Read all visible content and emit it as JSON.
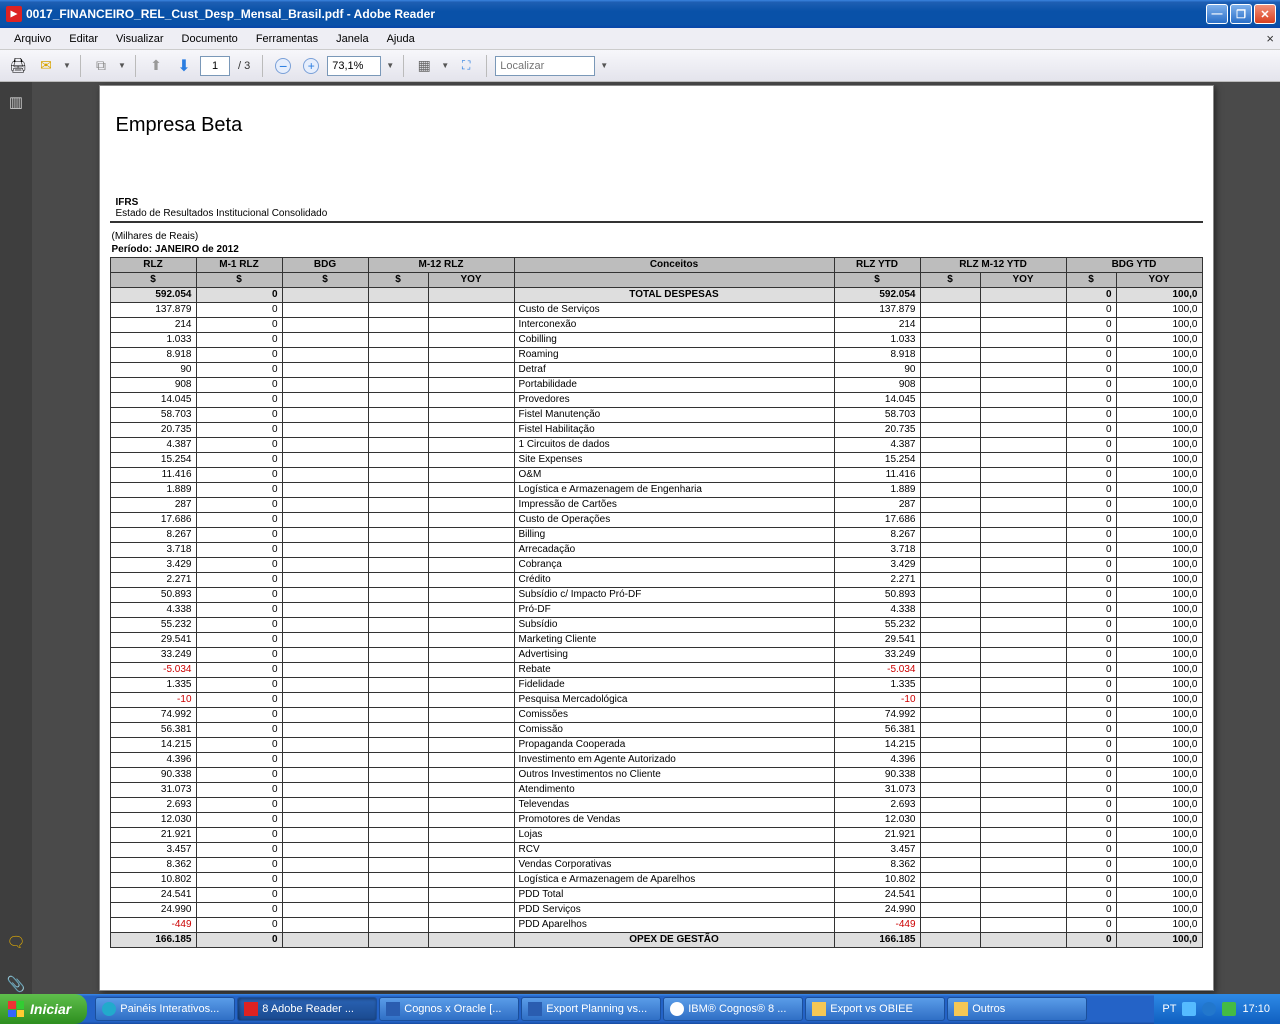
{
  "window": {
    "title": "0017_FINANCEIRO_REL_Cust_Desp_Mensal_Brasil.pdf - Adobe Reader"
  },
  "menu": [
    "Arquivo",
    "Editar",
    "Visualizar",
    "Documento",
    "Ferramentas",
    "Janela",
    "Ajuda"
  ],
  "toolbar": {
    "page_current": "1",
    "page_count": "/ 3",
    "zoom": "73,1%",
    "find_placeholder": "Localizar"
  },
  "document": {
    "company": "Empresa Beta",
    "ifrs": "IFRS",
    "ifrs_sub": "Estado de Resultados Institucional Consolidado",
    "currency_note": "(Milhares de Reais)",
    "period": "Período: JANEIRO de 2012",
    "headers1": [
      "RLZ",
      "M-1 RLZ",
      "BDG",
      "M-12 RLZ",
      "",
      "Conceitos",
      "RLZ YTD",
      "RLZ M-12 YTD",
      "",
      "BDG YTD",
      ""
    ],
    "headers2": [
      "$",
      "$",
      "$",
      "$",
      "YOY",
      "",
      "$",
      "$",
      "YOY",
      "$",
      "YOY"
    ],
    "total_row": {
      "rlz": "592.054",
      "m1": "0",
      "bdg": "",
      "m12": "",
      "yoy": "",
      "concept": "TOTAL DESPESAS",
      "rlz_ytd": "592.054",
      "m12_ytd": "",
      "yoy2": "",
      "bdg_ytd": "0",
      "yoy3": "100,0"
    },
    "rows": [
      {
        "rlz": "137.879",
        "m1": "0",
        "bdg": "",
        "m12": "",
        "yoy": "",
        "concept": "Custo de Serviços",
        "rlz_ytd": "137.879",
        "m12_ytd": "",
        "yoy2": "",
        "bdg_ytd": "0",
        "yoy3": "100,0"
      },
      {
        "rlz": "214",
        "m1": "0",
        "bdg": "",
        "m12": "",
        "yoy": "",
        "concept": "Interconexão",
        "rlz_ytd": "214",
        "m12_ytd": "",
        "yoy2": "",
        "bdg_ytd": "0",
        "yoy3": "100,0"
      },
      {
        "rlz": "1.033",
        "m1": "0",
        "bdg": "",
        "m12": "",
        "yoy": "",
        "concept": "Cobilling",
        "rlz_ytd": "1.033",
        "m12_ytd": "",
        "yoy2": "",
        "bdg_ytd": "0",
        "yoy3": "100,0"
      },
      {
        "rlz": "8.918",
        "m1": "0",
        "bdg": "",
        "m12": "",
        "yoy": "",
        "concept": "Roaming",
        "rlz_ytd": "8.918",
        "m12_ytd": "",
        "yoy2": "",
        "bdg_ytd": "0",
        "yoy3": "100,0"
      },
      {
        "rlz": "90",
        "m1": "0",
        "bdg": "",
        "m12": "",
        "yoy": "",
        "concept": "Detraf",
        "rlz_ytd": "90",
        "m12_ytd": "",
        "yoy2": "",
        "bdg_ytd": "0",
        "yoy3": "100,0"
      },
      {
        "rlz": "908",
        "m1": "0",
        "bdg": "",
        "m12": "",
        "yoy": "",
        "concept": "Portabilidade",
        "rlz_ytd": "908",
        "m12_ytd": "",
        "yoy2": "",
        "bdg_ytd": "0",
        "yoy3": "100,0"
      },
      {
        "rlz": "14.045",
        "m1": "0",
        "bdg": "",
        "m12": "",
        "yoy": "",
        "concept": "Provedores",
        "rlz_ytd": "14.045",
        "m12_ytd": "",
        "yoy2": "",
        "bdg_ytd": "0",
        "yoy3": "100,0"
      },
      {
        "rlz": "58.703",
        "m1": "0",
        "bdg": "",
        "m12": "",
        "yoy": "",
        "concept": "Fistel Manutenção",
        "rlz_ytd": "58.703",
        "m12_ytd": "",
        "yoy2": "",
        "bdg_ytd": "0",
        "yoy3": "100,0"
      },
      {
        "rlz": "20.735",
        "m1": "0",
        "bdg": "",
        "m12": "",
        "yoy": "",
        "concept": "Fistel Habilitação",
        "rlz_ytd": "20.735",
        "m12_ytd": "",
        "yoy2": "",
        "bdg_ytd": "0",
        "yoy3": "100,0"
      },
      {
        "rlz": "4.387",
        "m1": "0",
        "bdg": "",
        "m12": "",
        "yoy": "",
        "concept": "1 Circuitos de dados",
        "rlz_ytd": "4.387",
        "m12_ytd": "",
        "yoy2": "",
        "bdg_ytd": "0",
        "yoy3": "100,0"
      },
      {
        "rlz": "15.254",
        "m1": "0",
        "bdg": "",
        "m12": "",
        "yoy": "",
        "concept": "Site Expenses",
        "rlz_ytd": "15.254",
        "m12_ytd": "",
        "yoy2": "",
        "bdg_ytd": "0",
        "yoy3": "100,0"
      },
      {
        "rlz": "11.416",
        "m1": "0",
        "bdg": "",
        "m12": "",
        "yoy": "",
        "concept": "O&M",
        "rlz_ytd": "11.416",
        "m12_ytd": "",
        "yoy2": "",
        "bdg_ytd": "0",
        "yoy3": "100,0"
      },
      {
        "rlz": "1.889",
        "m1": "0",
        "bdg": "",
        "m12": "",
        "yoy": "",
        "concept": "Logística e Armazenagem de Engenharia",
        "rlz_ytd": "1.889",
        "m12_ytd": "",
        "yoy2": "",
        "bdg_ytd": "0",
        "yoy3": "100,0"
      },
      {
        "rlz": "287",
        "m1": "0",
        "bdg": "",
        "m12": "",
        "yoy": "",
        "concept": "Impressão de Cartões",
        "rlz_ytd": "287",
        "m12_ytd": "",
        "yoy2": "",
        "bdg_ytd": "0",
        "yoy3": "100,0"
      },
      {
        "rlz": "17.686",
        "m1": "0",
        "bdg": "",
        "m12": "",
        "yoy": "",
        "concept": "Custo de Operações",
        "rlz_ytd": "17.686",
        "m12_ytd": "",
        "yoy2": "",
        "bdg_ytd": "0",
        "yoy3": "100,0"
      },
      {
        "rlz": "8.267",
        "m1": "0",
        "bdg": "",
        "m12": "",
        "yoy": "",
        "concept": "Billing",
        "rlz_ytd": "8.267",
        "m12_ytd": "",
        "yoy2": "",
        "bdg_ytd": "0",
        "yoy3": "100,0"
      },
      {
        "rlz": "3.718",
        "m1": "0",
        "bdg": "",
        "m12": "",
        "yoy": "",
        "concept": "Arrecadação",
        "rlz_ytd": "3.718",
        "m12_ytd": "",
        "yoy2": "",
        "bdg_ytd": "0",
        "yoy3": "100,0"
      },
      {
        "rlz": "3.429",
        "m1": "0",
        "bdg": "",
        "m12": "",
        "yoy": "",
        "concept": "Cobrança",
        "rlz_ytd": "3.429",
        "m12_ytd": "",
        "yoy2": "",
        "bdg_ytd": "0",
        "yoy3": "100,0"
      },
      {
        "rlz": "2.271",
        "m1": "0",
        "bdg": "",
        "m12": "",
        "yoy": "",
        "concept": "Crédito",
        "rlz_ytd": "2.271",
        "m12_ytd": "",
        "yoy2": "",
        "bdg_ytd": "0",
        "yoy3": "100,0"
      },
      {
        "rlz": "50.893",
        "m1": "0",
        "bdg": "",
        "m12": "",
        "yoy": "",
        "concept": "Subsídio c/ Impacto Pró-DF",
        "rlz_ytd": "50.893",
        "m12_ytd": "",
        "yoy2": "",
        "bdg_ytd": "0",
        "yoy3": "100,0"
      },
      {
        "rlz": "4.338",
        "m1": "0",
        "bdg": "",
        "m12": "",
        "yoy": "",
        "concept": "Pró-DF",
        "rlz_ytd": "4.338",
        "m12_ytd": "",
        "yoy2": "",
        "bdg_ytd": "0",
        "yoy3": "100,0"
      },
      {
        "rlz": "55.232",
        "m1": "0",
        "bdg": "",
        "m12": "",
        "yoy": "",
        "concept": "Subsídio",
        "rlz_ytd": "55.232",
        "m12_ytd": "",
        "yoy2": "",
        "bdg_ytd": "0",
        "yoy3": "100,0"
      },
      {
        "rlz": "29.541",
        "m1": "0",
        "bdg": "",
        "m12": "",
        "yoy": "",
        "concept": "Marketing Cliente",
        "rlz_ytd": "29.541",
        "m12_ytd": "",
        "yoy2": "",
        "bdg_ytd": "0",
        "yoy3": "100,0"
      },
      {
        "rlz": "33.249",
        "m1": "0",
        "bdg": "",
        "m12": "",
        "yoy": "",
        "concept": "Advertising",
        "rlz_ytd": "33.249",
        "m12_ytd": "",
        "yoy2": "",
        "bdg_ytd": "0",
        "yoy3": "100,0"
      },
      {
        "rlz": "-5.034",
        "m1": "0",
        "bdg": "",
        "m12": "",
        "yoy": "",
        "concept": "Rebate",
        "rlz_ytd": "-5.034",
        "m12_ytd": "",
        "yoy2": "",
        "bdg_ytd": "0",
        "yoy3": "100,0",
        "neg": true
      },
      {
        "rlz": "1.335",
        "m1": "0",
        "bdg": "",
        "m12": "",
        "yoy": "",
        "concept": "Fidelidade",
        "rlz_ytd": "1.335",
        "m12_ytd": "",
        "yoy2": "",
        "bdg_ytd": "0",
        "yoy3": "100,0"
      },
      {
        "rlz": "-10",
        "m1": "0",
        "bdg": "",
        "m12": "",
        "yoy": "",
        "concept": "Pesquisa Mercadológica",
        "rlz_ytd": "-10",
        "m12_ytd": "",
        "yoy2": "",
        "bdg_ytd": "0",
        "yoy3": "100,0",
        "neg": true
      },
      {
        "rlz": "74.992",
        "m1": "0",
        "bdg": "",
        "m12": "",
        "yoy": "",
        "concept": "Comissões",
        "rlz_ytd": "74.992",
        "m12_ytd": "",
        "yoy2": "",
        "bdg_ytd": "0",
        "yoy3": "100,0"
      },
      {
        "rlz": "56.381",
        "m1": "0",
        "bdg": "",
        "m12": "",
        "yoy": "",
        "concept": "Comissão",
        "rlz_ytd": "56.381",
        "m12_ytd": "",
        "yoy2": "",
        "bdg_ytd": "0",
        "yoy3": "100,0"
      },
      {
        "rlz": "14.215",
        "m1": "0",
        "bdg": "",
        "m12": "",
        "yoy": "",
        "concept": "Propaganda Cooperada",
        "rlz_ytd": "14.215",
        "m12_ytd": "",
        "yoy2": "",
        "bdg_ytd": "0",
        "yoy3": "100,0"
      },
      {
        "rlz": "4.396",
        "m1": "0",
        "bdg": "",
        "m12": "",
        "yoy": "",
        "concept": "Investimento em Agente Autorizado",
        "rlz_ytd": "4.396",
        "m12_ytd": "",
        "yoy2": "",
        "bdg_ytd": "0",
        "yoy3": "100,0"
      },
      {
        "rlz": "90.338",
        "m1": "0",
        "bdg": "",
        "m12": "",
        "yoy": "",
        "concept": "Outros Investimentos no Cliente",
        "rlz_ytd": "90.338",
        "m12_ytd": "",
        "yoy2": "",
        "bdg_ytd": "0",
        "yoy3": "100,0"
      },
      {
        "rlz": "31.073",
        "m1": "0",
        "bdg": "",
        "m12": "",
        "yoy": "",
        "concept": "Atendimento",
        "rlz_ytd": "31.073",
        "m12_ytd": "",
        "yoy2": "",
        "bdg_ytd": "0",
        "yoy3": "100,0"
      },
      {
        "rlz": "2.693",
        "m1": "0",
        "bdg": "",
        "m12": "",
        "yoy": "",
        "concept": "Televendas",
        "rlz_ytd": "2.693",
        "m12_ytd": "",
        "yoy2": "",
        "bdg_ytd": "0",
        "yoy3": "100,0"
      },
      {
        "rlz": "12.030",
        "m1": "0",
        "bdg": "",
        "m12": "",
        "yoy": "",
        "concept": "Promotores de Vendas",
        "rlz_ytd": "12.030",
        "m12_ytd": "",
        "yoy2": "",
        "bdg_ytd": "0",
        "yoy3": "100,0"
      },
      {
        "rlz": "21.921",
        "m1": "0",
        "bdg": "",
        "m12": "",
        "yoy": "",
        "concept": "Lojas",
        "rlz_ytd": "21.921",
        "m12_ytd": "",
        "yoy2": "",
        "bdg_ytd": "0",
        "yoy3": "100,0"
      },
      {
        "rlz": "3.457",
        "m1": "0",
        "bdg": "",
        "m12": "",
        "yoy": "",
        "concept": "RCV",
        "rlz_ytd": "3.457",
        "m12_ytd": "",
        "yoy2": "",
        "bdg_ytd": "0",
        "yoy3": "100,0"
      },
      {
        "rlz": "8.362",
        "m1": "0",
        "bdg": "",
        "m12": "",
        "yoy": "",
        "concept": "Vendas Corporativas",
        "rlz_ytd": "8.362",
        "m12_ytd": "",
        "yoy2": "",
        "bdg_ytd": "0",
        "yoy3": "100,0"
      },
      {
        "rlz": "10.802",
        "m1": "0",
        "bdg": "",
        "m12": "",
        "yoy": "",
        "concept": "Logística e Armazenagem de Aparelhos",
        "rlz_ytd": "10.802",
        "m12_ytd": "",
        "yoy2": "",
        "bdg_ytd": "0",
        "yoy3": "100,0"
      },
      {
        "rlz": "24.541",
        "m1": "0",
        "bdg": "",
        "m12": "",
        "yoy": "",
        "concept": "PDD Total",
        "rlz_ytd": "24.541",
        "m12_ytd": "",
        "yoy2": "",
        "bdg_ytd": "0",
        "yoy3": "100,0"
      },
      {
        "rlz": "24.990",
        "m1": "0",
        "bdg": "",
        "m12": "",
        "yoy": "",
        "concept": "PDD Serviços",
        "rlz_ytd": "24.990",
        "m12_ytd": "",
        "yoy2": "",
        "bdg_ytd": "0",
        "yoy3": "100,0"
      },
      {
        "rlz": "-449",
        "m1": "0",
        "bdg": "",
        "m12": "",
        "yoy": "",
        "concept": "PDD Aparelhos",
        "rlz_ytd": "-449",
        "m12_ytd": "",
        "yoy2": "",
        "bdg_ytd": "0",
        "yoy3": "100,0",
        "neg": true
      }
    ],
    "opex_row": {
      "rlz": "166.185",
      "m1": "0",
      "bdg": "",
      "m12": "",
      "yoy": "",
      "concept": "OPEX DE GESTÃO",
      "rlz_ytd": "166.185",
      "m12_ytd": "",
      "yoy2": "",
      "bdg_ytd": "0",
      "yoy3": "100,0"
    }
  },
  "taskbar": {
    "start": "Iniciar",
    "items": [
      {
        "label": "Painéis Interativos...",
        "icon": "ie"
      },
      {
        "label": "8 Adobe Reader ...",
        "icon": "pdf",
        "active": true
      },
      {
        "label": "Cognos x Oracle [...",
        "icon": "word"
      },
      {
        "label": "Export Planning vs...",
        "icon": "word"
      },
      {
        "label": "IBM® Cognos® 8 ...",
        "icon": "cognos"
      },
      {
        "label": "Export vs OBIEE",
        "icon": "folder"
      },
      {
        "label": "Outros",
        "icon": "folder"
      }
    ],
    "lang": "PT",
    "clock": "17:10"
  }
}
